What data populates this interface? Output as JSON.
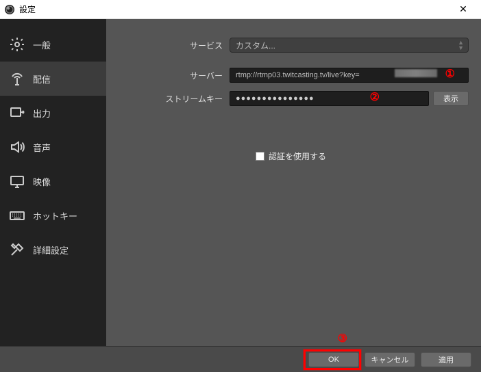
{
  "window": {
    "title": "設定"
  },
  "sidebar": {
    "items": [
      {
        "label": "一般"
      },
      {
        "label": "配信"
      },
      {
        "label": "出力"
      },
      {
        "label": "音声"
      },
      {
        "label": "映像"
      },
      {
        "label": "ホットキー"
      },
      {
        "label": "詳細設定"
      }
    ]
  },
  "form": {
    "service_label": "サービス",
    "service_value": "カスタム...",
    "server_label": "サーバー",
    "server_value": "rtmp://rtmp03.twitcasting.tv/live?key=",
    "streamkey_label": "ストリームキー",
    "streamkey_mask": "●●●●●●●●●●●●●●●",
    "show_button": "表示",
    "auth_label": "認証を使用する"
  },
  "footer": {
    "ok": "OK",
    "cancel": "キャンセル",
    "apply": "適用"
  },
  "annotations": {
    "one": "①",
    "two": "②",
    "three": "③"
  }
}
